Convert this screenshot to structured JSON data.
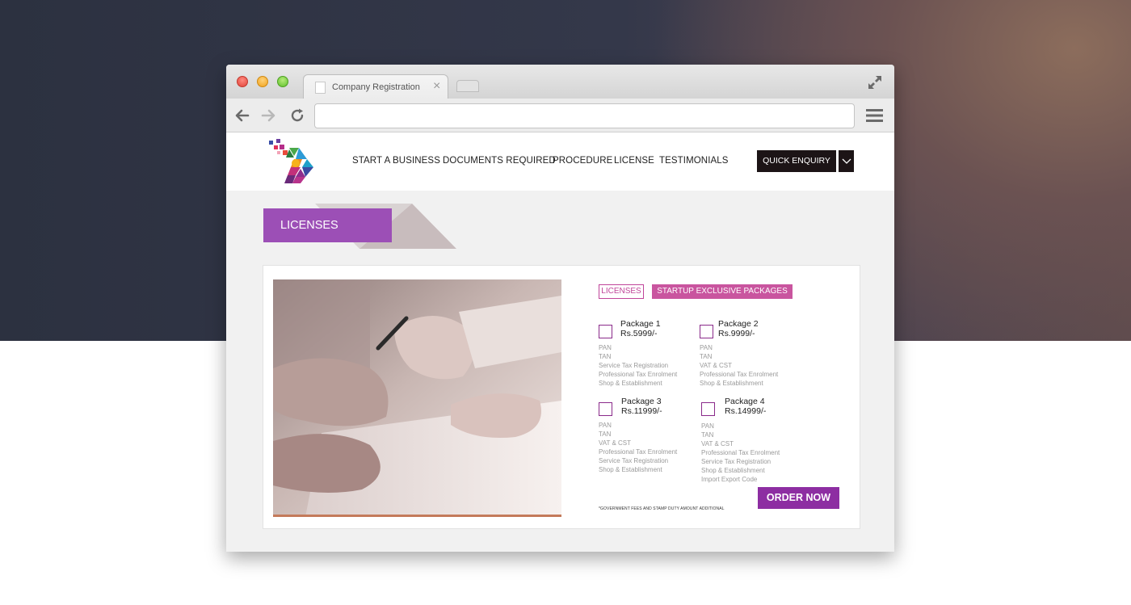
{
  "browser": {
    "tab_title": "Company Registration",
    "address": ""
  },
  "site": {
    "nav": [
      "START A BUSINESS",
      "DOCUMENTS REQUIRED",
      "PROCEDURE",
      "LICENSE",
      "TESTIMONIALS"
    ],
    "quick_enquiry": "QUICK ENQUIRY"
  },
  "page": {
    "heading": "LICENSES",
    "tabs": {
      "licenses": "LICENSES",
      "startup": "STARTUP EXCLUSIVE PACKAGES"
    },
    "packages": [
      {
        "name": "Package 1",
        "price": "Rs.5999/-",
        "features": [
          "PAN",
          "TAN",
          "Service Tax Registration",
          "Professional Tax Enrolment",
          "Shop & Establishment"
        ]
      },
      {
        "name": "Package 2",
        "price": "Rs.9999/-",
        "features": [
          "PAN",
          "TAN",
          "VAT & CST",
          "Professional Tax Enrolment",
          "Shop & Establishment"
        ]
      },
      {
        "name": "Package 3",
        "price": "Rs.11999/-",
        "features": [
          "PAN",
          "TAN",
          "VAT & CST",
          "Professional Tax Enrolment",
          "Service Tax Registration",
          "Shop & Establishment"
        ]
      },
      {
        "name": "Package 4",
        "price": "Rs.14999/-",
        "features": [
          "PAN",
          "TAN",
          "VAT & CST",
          "Professional Tax Enrolment",
          "Service Tax Registration",
          "Shop & Establishment",
          "Import Export Code"
        ]
      }
    ],
    "disclaimer": "*GOVERNMENT FEES AND STAMP DUTY AMOUNT ADDITIONAL",
    "order_button": "ORDER NOW"
  },
  "colors": {
    "accent_purple": "#9c4fb6",
    "tab_pink": "#c9559f",
    "order_purple": "#8d2ea2",
    "enquiry_dark": "#1c1416"
  }
}
